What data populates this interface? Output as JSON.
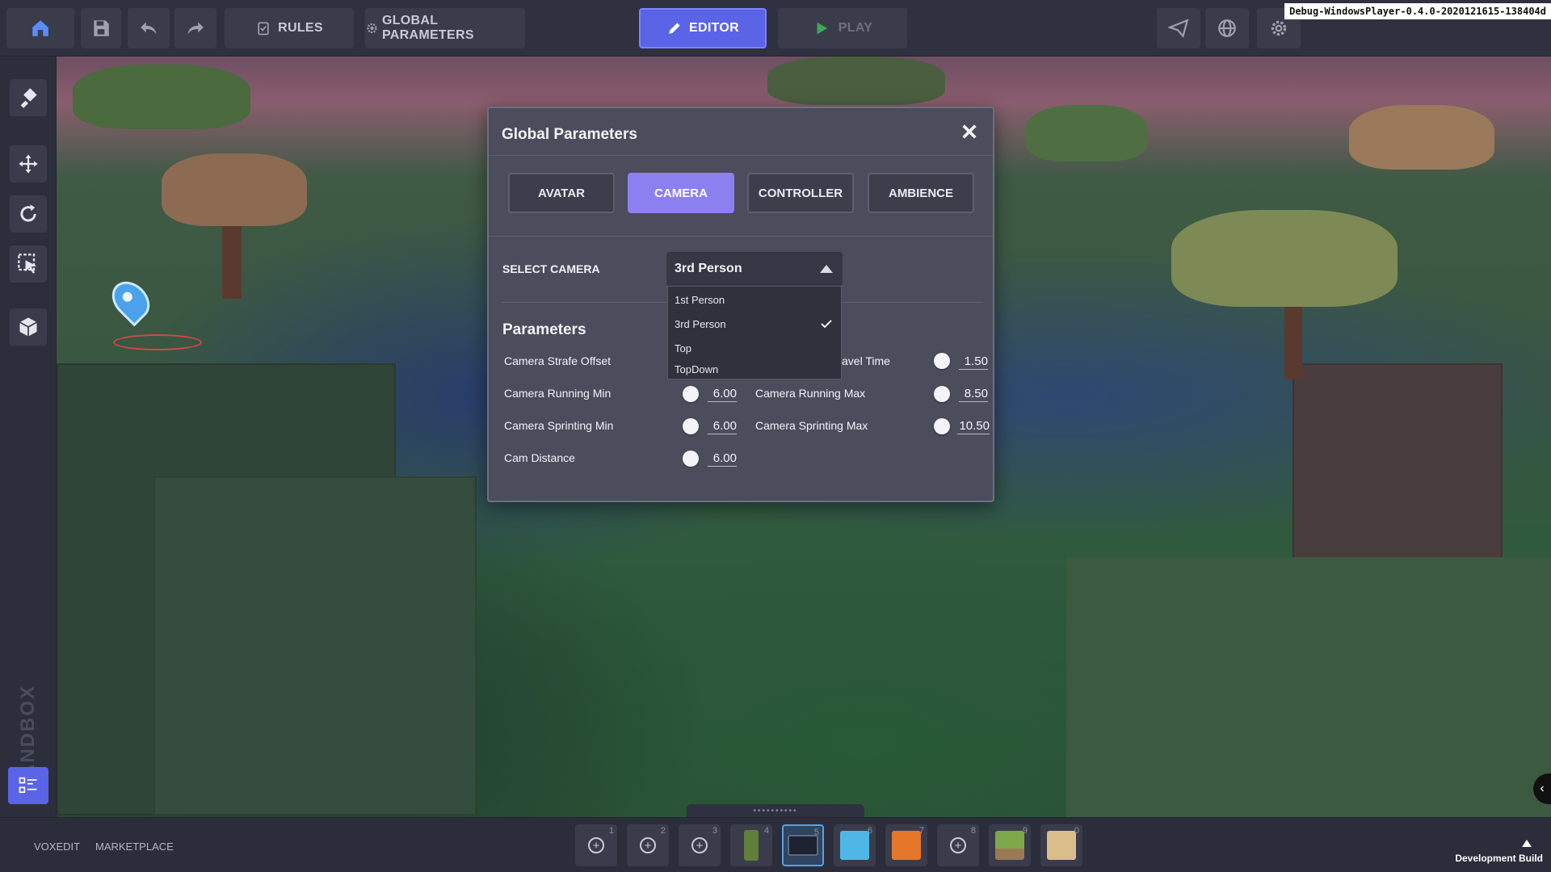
{
  "topbar": {
    "rules_label": "RULES",
    "global_params_label": "GLOBAL PARAMETERS",
    "editor_label": "EDITOR",
    "play_label": "PLAY",
    "build_label": "Debug-WindowsPlayer-0.4.0-2020121615-138404d",
    "icons": [
      "home-icon",
      "save-icon",
      "undo-icon",
      "redo-icon",
      "share-icon",
      "globe-icon",
      "gear-icon"
    ]
  },
  "sidebar": {
    "tools": [
      "paint-icon",
      "move-icon",
      "rotate-icon",
      "select-icon",
      "cube-add-icon"
    ],
    "brand": "SANDBOX",
    "bottom_tool": "list-icon"
  },
  "modal": {
    "title": "Global Parameters",
    "tabs": [
      {
        "label": "AVATAR",
        "active": false
      },
      {
        "label": "CAMERA",
        "active": true
      },
      {
        "label": "CONTROLLER",
        "active": false
      },
      {
        "label": "AMBIENCE",
        "active": false
      }
    ],
    "select_camera_label": "SELECT CAMERA",
    "selected_camera": "3rd Person",
    "camera_options": [
      "1st Person",
      "3rd Person",
      "Top",
      "TopDown"
    ],
    "params_title": "Parameters",
    "params": [
      {
        "label": "Camera Strafe Offset",
        "value": ""
      },
      {
        "label": "avel Time",
        "value": "1.50"
      },
      {
        "label": "Camera Running Min",
        "value": "6.00"
      },
      {
        "label": "Camera Running Max",
        "value": "8.50"
      },
      {
        "label": "Camera Sprinting Min",
        "value": "6.00"
      },
      {
        "label": "Camera Sprinting Max",
        "value": "10.50"
      },
      {
        "label": "Cam Distance",
        "value": "6.00"
      }
    ]
  },
  "bottombar": {
    "voxedit_label": "VOXEDIT",
    "marketplace_label": "MARKETPLACE",
    "slots": [
      {
        "num": "1",
        "kind": "empty"
      },
      {
        "num": "2",
        "kind": "empty"
      },
      {
        "num": "3",
        "kind": "empty"
      },
      {
        "num": "4",
        "kind": "vine",
        "color": "#5f7f3a"
      },
      {
        "num": "5",
        "kind": "selected",
        "color": "#2f3340"
      },
      {
        "num": "6",
        "kind": "water",
        "color": "#4fb7e6"
      },
      {
        "num": "7",
        "kind": "lava",
        "color": "#e5772a"
      },
      {
        "num": "8",
        "kind": "empty"
      },
      {
        "num": "9",
        "kind": "grass",
        "color": "#7fa84a"
      },
      {
        "num": "0",
        "kind": "sand",
        "color": "#d9bd8a"
      }
    ],
    "dev_build_label": "Development Build"
  },
  "colors": {
    "accent": "#5b63e6",
    "tab_active": "#8c7ff0",
    "modal_bg": "#4b4d5c",
    "panel_bg": "#2f3140"
  }
}
